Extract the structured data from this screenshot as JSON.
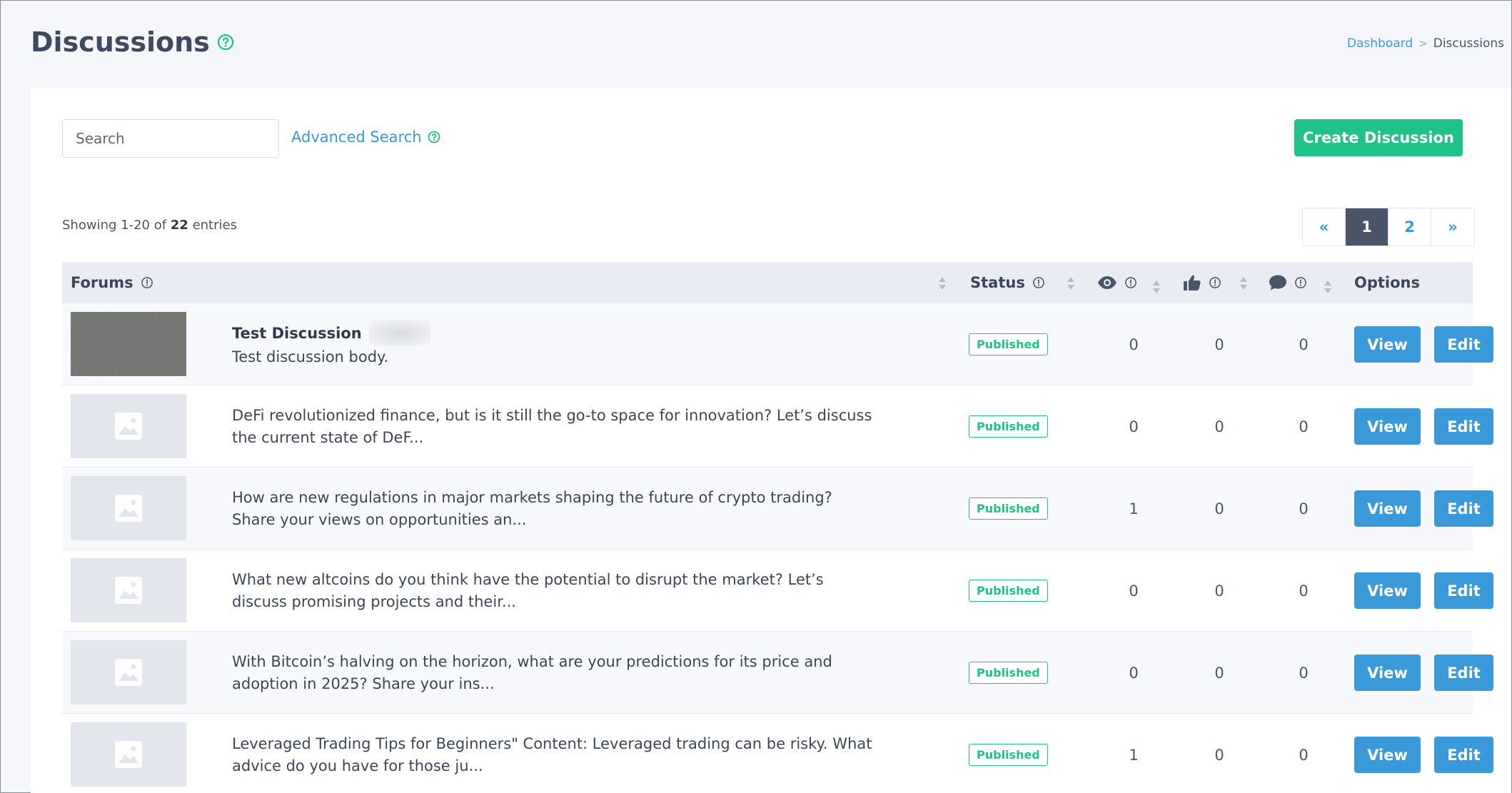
{
  "header": {
    "title": "Discussions",
    "breadcrumb": {
      "home": "Dashboard",
      "separator": ">",
      "current": "Discussions"
    }
  },
  "toolbar": {
    "search_placeholder": "Search",
    "advanced_search": "Advanced Search",
    "create_button": "Create Discussion"
  },
  "summary": {
    "prefix": "Showing 1-20 of ",
    "total": "22",
    "suffix": " entries"
  },
  "pagination": {
    "prev": "«",
    "pages": [
      "1",
      "2"
    ],
    "active": "1",
    "next": "»"
  },
  "table": {
    "headers": {
      "forums": "Forums",
      "status": "Status",
      "options": "Options"
    },
    "header_icons": [
      "eye-icon",
      "thumbs-up-icon",
      "comment-icon"
    ],
    "rows": [
      {
        "title": "Test Discussion",
        "body": "Test discussion body.",
        "status": "Published",
        "views": "0",
        "likes": "0",
        "comments": "0",
        "view_label": "View",
        "edit_label": "Edit"
      },
      {
        "title": "",
        "body": "DeFi revolutionized finance, but is it still the go-to space for innovation? Let’s discuss the current state of DeF...",
        "status": "Published",
        "views": "0",
        "likes": "0",
        "comments": "0",
        "view_label": "View",
        "edit_label": "Edit"
      },
      {
        "title": "",
        "body": "How are new regulations in major markets shaping the future of crypto trading? Share your views on opportunities an...",
        "status": "Published",
        "views": "1",
        "likes": "0",
        "comments": "0",
        "view_label": "View",
        "edit_label": "Edit"
      },
      {
        "title": "",
        "body": "What new altcoins do you think have the potential to disrupt the market? Let’s discuss promising projects and their...",
        "status": "Published",
        "views": "0",
        "likes": "0",
        "comments": "0",
        "view_label": "View",
        "edit_label": "Edit"
      },
      {
        "title": "",
        "body": "With Bitcoin’s halving on the horizon, what are your predictions for its price and adoption in 2025? Share your ins...",
        "status": "Published",
        "views": "0",
        "likes": "0",
        "comments": "0",
        "view_label": "View",
        "edit_label": "Edit"
      },
      {
        "title": "",
        "body": "Leveraged Trading Tips for Beginners\" Content: Leveraged trading can be risky. What advice do you have for those ju...",
        "status": "Published",
        "views": "1",
        "likes": "0",
        "comments": "0",
        "view_label": "View",
        "edit_label": "Edit"
      }
    ]
  },
  "colors": {
    "accent": "#1fc287",
    "primary": "#3a9ad9",
    "header_bg": "#e9ecf3",
    "active_page": "#4a5568"
  }
}
